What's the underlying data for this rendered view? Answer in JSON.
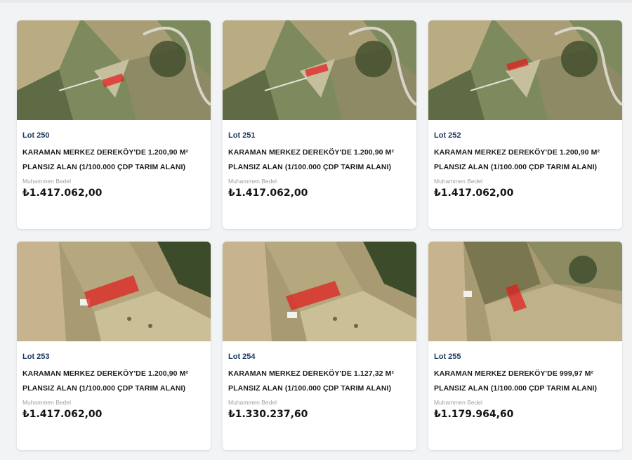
{
  "lots": [
    {
      "lot": "Lot 250",
      "title_line1": "KARAMAN MERKEZ DEREKÖY'DE 1.200,90 M²",
      "title_line2": "PLANSIZ ALAN (1/100.000 ÇDP TARIM ALANI)",
      "price_label": "Muhammen Bedel",
      "price": "₺1.417.062,00"
    },
    {
      "lot": "Lot 251",
      "title_line1": "KARAMAN MERKEZ DEREKÖY'DE 1.200,90 M²",
      "title_line2": "PLANSIZ ALAN (1/100.000 ÇDP TARIM ALANI)",
      "price_label": "Muhammen Bedel",
      "price": "₺1.417.062,00"
    },
    {
      "lot": "Lot 252",
      "title_line1": "KARAMAN MERKEZ DEREKÖY'DE 1.200,90 M²",
      "title_line2": "PLANSIZ ALAN (1/100.000 ÇDP TARIM ALANI)",
      "price_label": "Muhammen Bedel",
      "price": "₺1.417.062,00"
    },
    {
      "lot": "Lot 253",
      "title_line1": "KARAMAN MERKEZ DEREKÖY'DE 1.200,90 M²",
      "title_line2": "PLANSIZ ALAN (1/100.000 ÇDP TARIM ALANI)",
      "price_label": "Muhammen Bedel",
      "price": "₺1.417.062,00"
    },
    {
      "lot": "Lot 254",
      "title_line1": "KARAMAN MERKEZ DEREKÖY'DE 1.127,32 M²",
      "title_line2": "PLANSIZ ALAN (1/100.000 ÇDP TARIM ALANI)",
      "price_label": "Muhammen Bedel",
      "price": "₺1.330.237,60"
    },
    {
      "lot": "Lot 255",
      "title_line1": "KARAMAN MERKEZ DEREKÖY'DE 999,97 M²",
      "title_line2": "PLANSIZ ALAN (1/100.000 ÇDP TARIM ALANI)",
      "price_label": "Muhammen Bedel",
      "price": "₺1.179.964,60"
    }
  ],
  "colors": {
    "parcel_highlight": "#e02020",
    "lot_number": "#1f3a60"
  }
}
